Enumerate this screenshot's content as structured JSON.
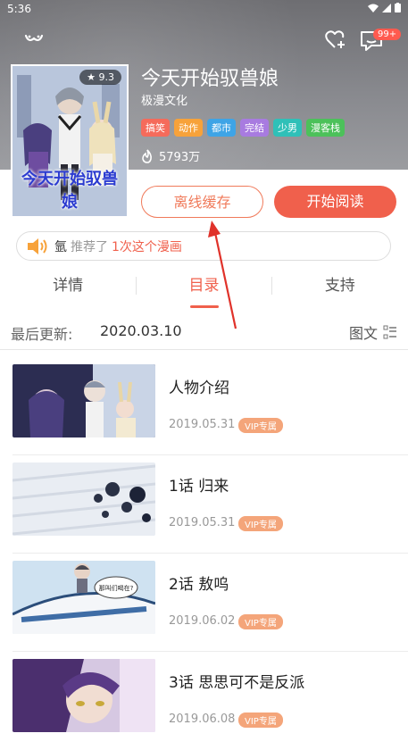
{
  "status_bar": {
    "time": "5:36"
  },
  "header": {
    "notification_badge": "99+"
  },
  "comic": {
    "rating": "9.3",
    "cover_text": "今天开始驭兽娘",
    "title": "今天开始驭兽娘",
    "publisher": "极漫文化",
    "tags": [
      {
        "label": "搞笑",
        "color": "#f56b5b"
      },
      {
        "label": "动作",
        "color": "#f7a23a"
      },
      {
        "label": "都市",
        "color": "#3ea4e6"
      },
      {
        "label": "完结",
        "color": "#a87be0"
      },
      {
        "label": "少男",
        "color": "#2fc0b8"
      },
      {
        "label": "漫客栈",
        "color": "#4cc15a"
      }
    ],
    "views": "5793万"
  },
  "actions": {
    "offline_label": "离线缓存",
    "read_label": "开始阅读"
  },
  "recommend": {
    "user": "氩",
    "middle": "推荐了",
    "count": "1次这个漫画"
  },
  "tabs": [
    {
      "label": "详情",
      "active": false
    },
    {
      "label": "目录",
      "active": true
    },
    {
      "label": "支持",
      "active": false
    }
  ],
  "catalog": {
    "update_label": "最后更新:",
    "update_date": "2020.03.10",
    "view_mode_label": "图文"
  },
  "chapters": [
    {
      "title": "人物介绍",
      "date": "2019.05.31",
      "vip": "VIP专属"
    },
    {
      "title": "1话   归来",
      "date": "2019.05.31",
      "vip": "VIP专属"
    },
    {
      "title": "2话   敖呜",
      "date": "2019.06.02",
      "vip": "VIP专属",
      "thumb_bubble": "那叫们喝在?"
    },
    {
      "title": "3话   思思可不是反派",
      "date": "2019.06.08",
      "vip": "VIP专属"
    }
  ],
  "colors": {
    "accent": "#f0604c",
    "vip": "#f4a57a"
  }
}
